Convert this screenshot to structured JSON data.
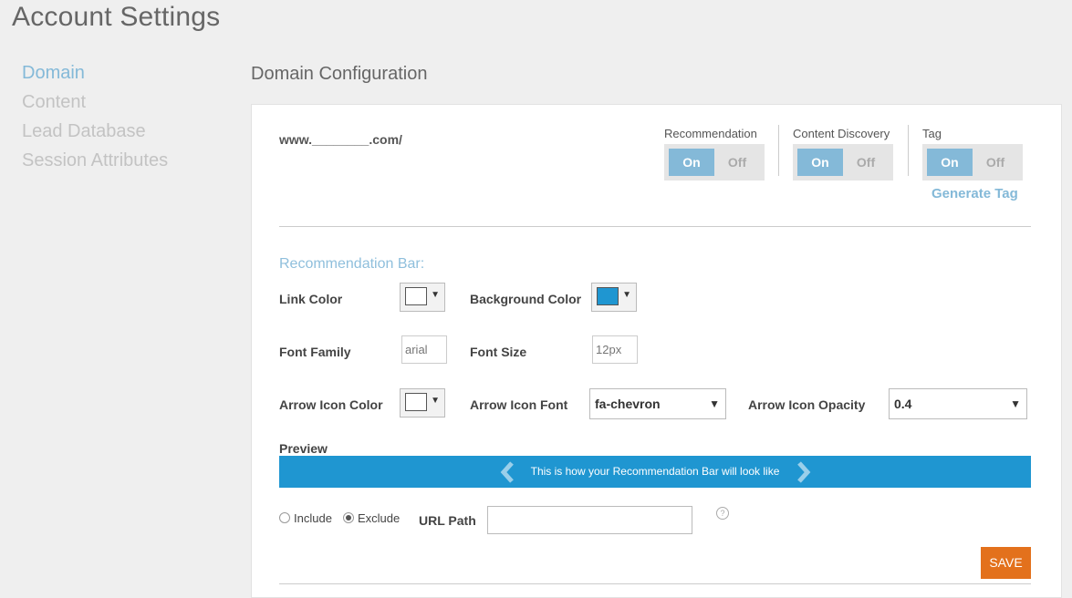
{
  "page": {
    "title": "Account Settings"
  },
  "sidebar": {
    "items": [
      {
        "label": "Domain",
        "active": true
      },
      {
        "label": "Content"
      },
      {
        "label": "Lead Database"
      },
      {
        "label": "Session Attributes"
      }
    ]
  },
  "section": {
    "title": "Domain Configuration"
  },
  "domain": {
    "prefix": "www.",
    "blank": "________",
    "suffix": ".com/"
  },
  "toggles": {
    "recommendation": {
      "label": "Recommendation",
      "on": "On",
      "off": "Off"
    },
    "content_discovery": {
      "label": "Content Discovery",
      "on": "On",
      "off": "Off"
    },
    "tag": {
      "label": "Tag",
      "on": "On",
      "off": "Off"
    }
  },
  "generate_tag": "Generate Tag",
  "rec_bar": {
    "heading": "Recommendation Bar:",
    "link_color_label": "Link Color",
    "link_color": "#ffffff",
    "bg_color_label": "Background Color",
    "bg_color": "#1f96d1",
    "font_family_label": "Font Family",
    "font_family_placeholder": "arial",
    "font_size_label": "Font Size",
    "font_size_placeholder": "12px",
    "arrow_color_label": "Arrow Icon Color",
    "arrow_color": "#ffffff",
    "arrow_font_label": "Arrow Icon Font",
    "arrow_font_value": "fa-chevron",
    "arrow_opacity_label": "Arrow Icon Opacity",
    "arrow_opacity_value": "0.4"
  },
  "preview": {
    "label": "Preview",
    "text": "This is how your Recommendation Bar will look like"
  },
  "url_filter": {
    "include_label": "Include",
    "exclude_label": "Exclude",
    "selected": "exclude",
    "url_path_label": "URL Path",
    "url_path_value": "",
    "help_glyph": "?"
  },
  "save_label": "SAVE"
}
